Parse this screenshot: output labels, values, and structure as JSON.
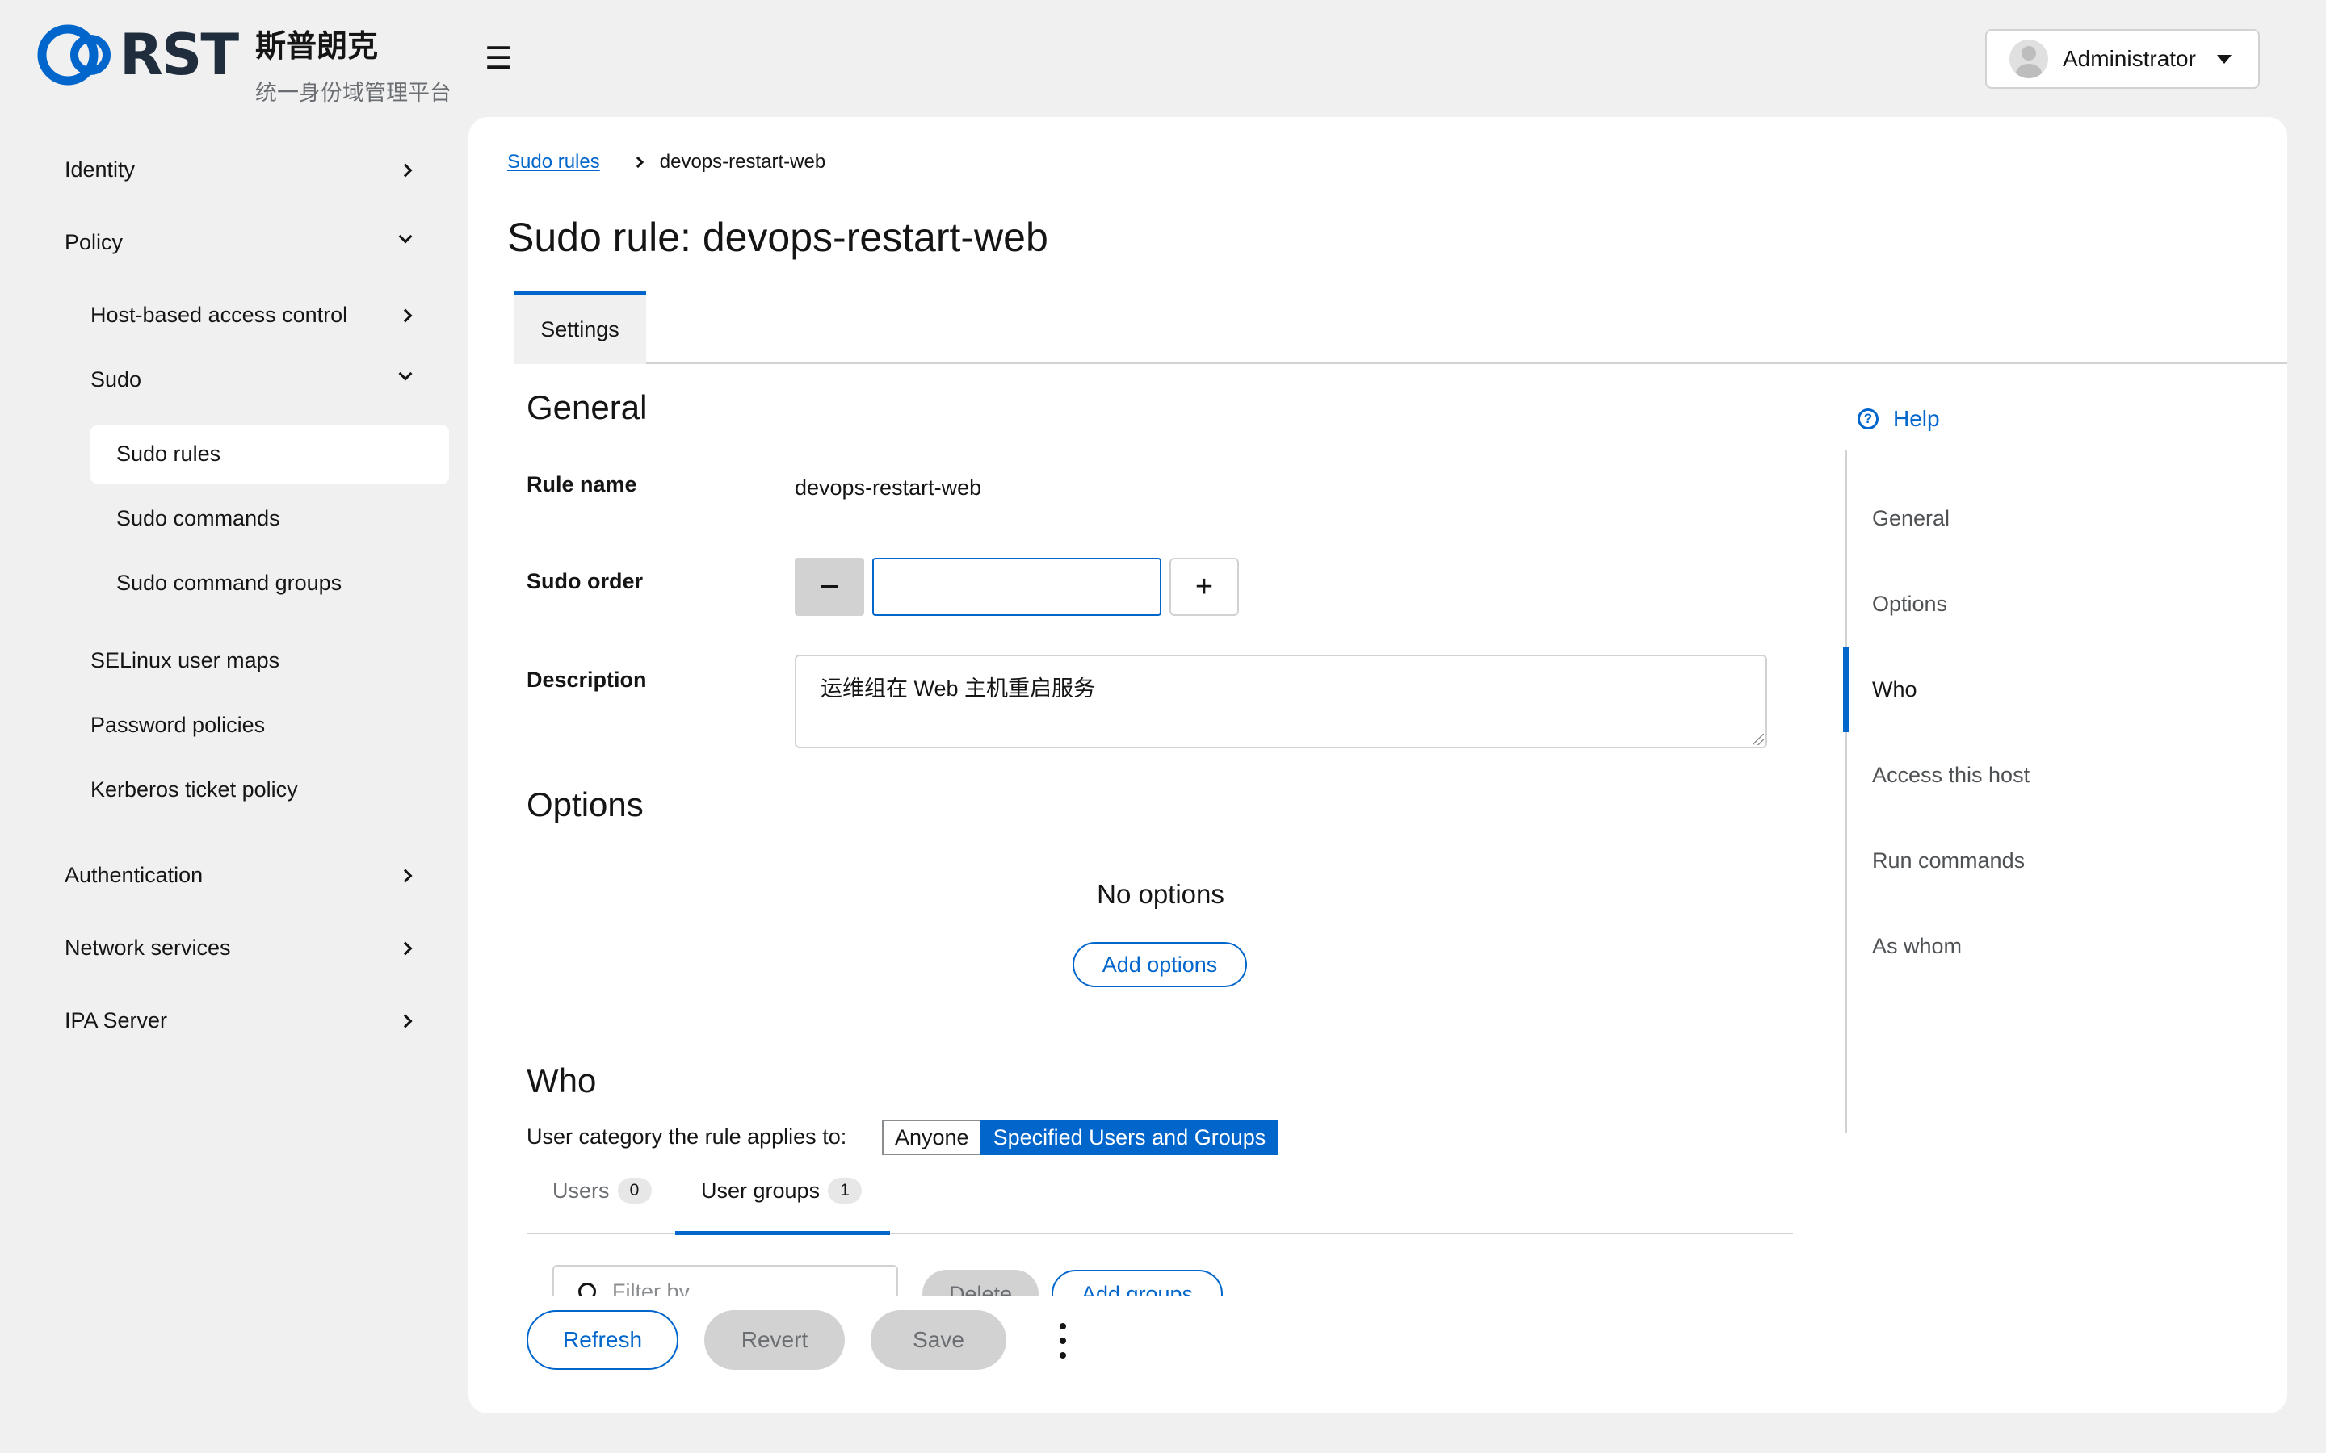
{
  "brand": {
    "logo_text": "RST",
    "title": "斯普朗克",
    "subtitle": "统一身份域管理平台",
    "accent": "#0066cc"
  },
  "header": {
    "menu_icon": "hamburger-icon",
    "user": "Administrator"
  },
  "sidebar": {
    "items": [
      {
        "label": "Identity",
        "icon": "chevron-right-icon"
      },
      {
        "label": "Policy",
        "icon": "chevron-down-icon"
      },
      {
        "label": "Host-based access control",
        "icon": "chevron-right-icon"
      },
      {
        "label": "Sudo",
        "icon": "chevron-down-icon"
      },
      {
        "label": "Sudo rules",
        "active": true
      },
      {
        "label": "Sudo commands"
      },
      {
        "label": "Sudo command groups"
      },
      {
        "label": "SELinux user maps"
      },
      {
        "label": "Password policies"
      },
      {
        "label": "Kerberos ticket policy"
      },
      {
        "label": "Authentication",
        "icon": "chevron-right-icon"
      },
      {
        "label": "Network services",
        "icon": "chevron-right-icon"
      },
      {
        "label": "IPA Server",
        "icon": "chevron-right-icon"
      }
    ]
  },
  "breadcrumb": {
    "parent": "Sudo rules",
    "current": "devops-restart-web"
  },
  "page": {
    "title": "Sudo rule: devops-restart-web",
    "tab": "Settings"
  },
  "general": {
    "heading": "General",
    "rule_name_label": "Rule name",
    "rule_name_value": "devops-restart-web",
    "sudo_order_label": "Sudo order",
    "sudo_order_value": "",
    "description_label": "Description",
    "description_value": "运维组在 Web 主机重启服务"
  },
  "options": {
    "heading": "Options",
    "empty_text": "No options",
    "add_button": "Add options"
  },
  "who": {
    "heading": "Who",
    "category_label": "User category the rule applies to:",
    "category_options": [
      "Anyone",
      "Specified Users and Groups"
    ],
    "category_selected": "Specified Users and Groups",
    "tabs": [
      {
        "label": "Users",
        "count": "0"
      },
      {
        "label": "User groups",
        "count": "1",
        "active": true
      }
    ],
    "filter_placeholder": "Filter by",
    "delete_button": "Delete",
    "add_groups_button": "Add groups"
  },
  "footer": {
    "refresh": "Refresh",
    "revert": "Revert",
    "save": "Save"
  },
  "jump_links": {
    "help": "Help",
    "items": [
      "General",
      "Options",
      "Who",
      "Access this host",
      "Run commands",
      "As whom"
    ],
    "active": "Who"
  }
}
